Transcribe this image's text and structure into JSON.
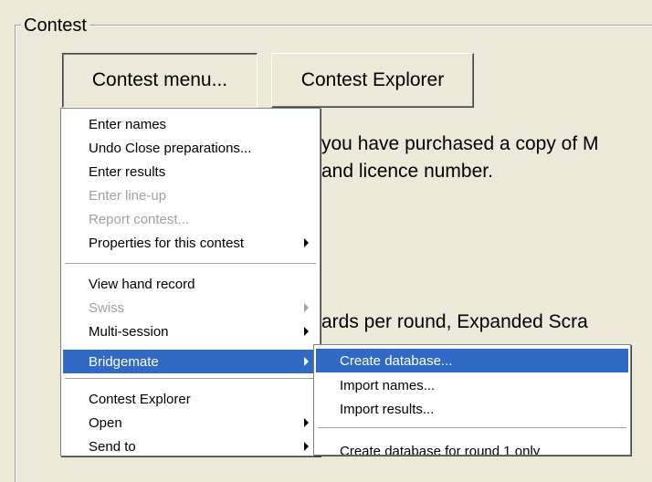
{
  "group": {
    "title": "Contest"
  },
  "buttons": {
    "contest_menu": "Contest menu...",
    "contest_explorer": "Contest Explorer"
  },
  "background_text": {
    "line1": "you have purchased a copy of M",
    "line2": "and licence number.",
    "line3": "ards per round, Expanded Scra"
  },
  "main_menu": {
    "items": [
      {
        "label": "Enter names"
      },
      {
        "label": "Undo Close preparations..."
      },
      {
        "label": "Enter results"
      },
      {
        "label": "Enter line-up"
      },
      {
        "label": "Report contest..."
      },
      {
        "label": "Properties for this contest"
      },
      {
        "label": "View hand record"
      },
      {
        "label": "Swiss"
      },
      {
        "label": "Multi-session"
      },
      {
        "label": "Bridgemate"
      },
      {
        "label": "Contest Explorer"
      },
      {
        "label": "Open"
      },
      {
        "label": "Send to"
      }
    ]
  },
  "sub_menu": {
    "items": [
      {
        "label": "Create database..."
      },
      {
        "label": "Import names..."
      },
      {
        "label": "Import results..."
      },
      {
        "label": "Create database for round 1 only"
      }
    ]
  },
  "colors": {
    "face": "#ece9d8",
    "menu_bg": "#ffffff",
    "highlight": "#316ac5",
    "disabled_text": "#a0a0a0"
  }
}
